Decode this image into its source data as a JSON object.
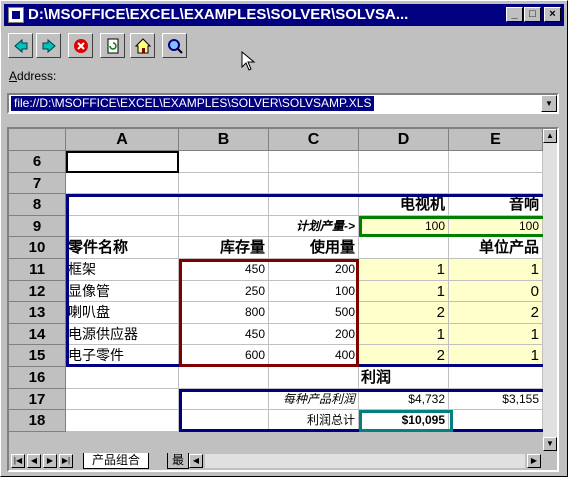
{
  "window": {
    "title": "D:\\MSOFFICE\\EXCEL\\EXAMPLES\\SOLVER\\SOLVSA..."
  },
  "toolbar": {
    "icons": [
      "back-arrow-icon",
      "forward-arrow-icon",
      "stop-icon",
      "refresh-icon",
      "home-icon",
      "search-icon"
    ]
  },
  "address": {
    "label_prefix": "",
    "label_underlined": "A",
    "label_rest": "ddress:",
    "value": "file://D:\\MSOFFICE\\EXCEL\\EXAMPLES\\SOLVER\\SOLVSAMP.XLS"
  },
  "sheet": {
    "columns": [
      "A",
      "B",
      "C",
      "D",
      "E"
    ],
    "rows": [
      {
        "num": "6",
        "cells": [
          "",
          "",
          "",
          "",
          ""
        ]
      },
      {
        "num": "7",
        "cells": [
          "",
          "",
          "",
          "",
          ""
        ]
      },
      {
        "num": "8",
        "cells": [
          "",
          "",
          "",
          "电视机",
          "音响"
        ]
      },
      {
        "num": "9",
        "cells": [
          "",
          "",
          "计划产量->",
          "100",
          "100"
        ]
      },
      {
        "num": "10",
        "cells": [
          "零件名称",
          "库存量",
          "使用量",
          "",
          "单位产品"
        ]
      },
      {
        "num": "11",
        "cells": [
          "框架",
          "450",
          "200",
          "1",
          "1"
        ]
      },
      {
        "num": "12",
        "cells": [
          "显像管",
          "250",
          "100",
          "1",
          "0"
        ]
      },
      {
        "num": "13",
        "cells": [
          "喇叭盘",
          "800",
          "500",
          "2",
          "2"
        ]
      },
      {
        "num": "14",
        "cells": [
          "电源供应器",
          "450",
          "200",
          "1",
          "1"
        ]
      },
      {
        "num": "15",
        "cells": [
          "电子零件",
          "600",
          "400",
          "2",
          "1"
        ]
      },
      {
        "num": "16",
        "cells": [
          "",
          "",
          "",
          "利润",
          ""
        ]
      },
      {
        "num": "17",
        "cells": [
          "",
          "",
          "每种产品利润",
          "$4,732",
          "$3,155"
        ]
      },
      {
        "num": "18",
        "cells": [
          "",
          "",
          "利润总计",
          "$10,095",
          ""
        ]
      }
    ]
  },
  "tabs": {
    "active": "产品组合",
    "next": "最"
  },
  "colors": {
    "title_bg": "#000080",
    "box_navy": "#000080",
    "box_maroon": "#800000",
    "box_green": "#008000",
    "box_teal": "#008080",
    "cell_yellow": "#ffffcc"
  }
}
